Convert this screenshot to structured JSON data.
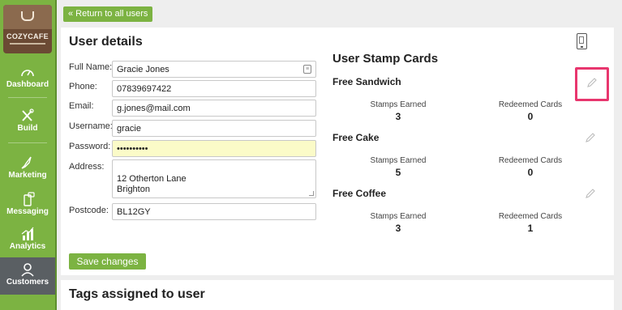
{
  "app": {
    "logo_text": "COZYCAFE",
    "brand_color": "#7cb342"
  },
  "sidebar": {
    "items": [
      {
        "label": "Dashboard",
        "icon": "gauge-icon"
      },
      {
        "label": "Build",
        "icon": "tools-icon"
      },
      {
        "label": "Marketing",
        "icon": "rocket-icon"
      },
      {
        "label": "Messaging",
        "icon": "phone-message-icon"
      },
      {
        "label": "Analytics",
        "icon": "chart-icon"
      },
      {
        "label": "Customers",
        "icon": "user-icon",
        "active": true
      }
    ]
  },
  "topbar": {
    "return_label": "« Return to all users"
  },
  "user_details": {
    "title": "User details",
    "fields": {
      "full_name": {
        "label": "Full Name:",
        "value": "Gracie Jones"
      },
      "phone": {
        "label": "Phone:",
        "value": "07839697422"
      },
      "email": {
        "label": "Email:",
        "value": "g.jones@mail.com"
      },
      "username": {
        "label": "Username:",
        "value": "gracie"
      },
      "password": {
        "label": "Password:",
        "value": "••••••••••"
      },
      "address": {
        "label": "Address:",
        "value": "12 Otherton Lane\nBrighton"
      },
      "postcode": {
        "label": "Postcode:",
        "value": "BL12GY"
      }
    },
    "save_label": "Save changes"
  },
  "stamp_cards": {
    "title": "User Stamp Cards",
    "stamps_label": "Stamps Earned",
    "redeemed_label": "Redeemed Cards",
    "cards": [
      {
        "name": "Free Sandwich",
        "stamps": "3",
        "redeemed": "0"
      },
      {
        "name": "Free Cake",
        "stamps": "5",
        "redeemed": "0"
      },
      {
        "name": "Free Coffee",
        "stamps": "3",
        "redeemed": "1"
      }
    ]
  },
  "tags": {
    "title": "Tags assigned to user"
  }
}
